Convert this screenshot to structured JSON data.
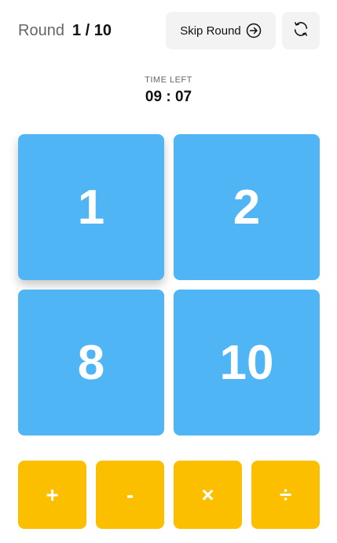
{
  "header": {
    "round_label": "Round",
    "round_value": "1 / 10",
    "skip_label": "Skip Round",
    "skip_icon": "arrow-right-circle-icon",
    "refresh_icon": "refresh-icon"
  },
  "timer": {
    "label": "TIME LEFT",
    "value": "09 : 07"
  },
  "tiles": [
    {
      "value": "1",
      "selected": true
    },
    {
      "value": "2",
      "selected": false
    },
    {
      "value": "8",
      "selected": false
    },
    {
      "value": "10",
      "selected": false
    }
  ],
  "operators": [
    {
      "symbol": "+",
      "name": "add"
    },
    {
      "symbol": "-",
      "name": "subtract"
    },
    {
      "symbol": "×",
      "name": "multiply"
    },
    {
      "symbol": "÷",
      "name": "divide"
    }
  ],
  "colors": {
    "tile": "#4fb5f5",
    "operator": "#fbbf00",
    "button_bg": "#f3f3f3"
  }
}
